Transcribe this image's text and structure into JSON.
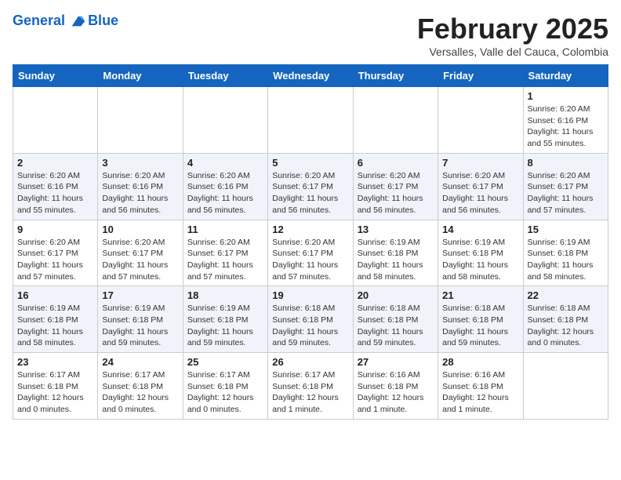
{
  "header": {
    "logo_line1": "General",
    "logo_line2": "Blue",
    "month": "February 2025",
    "location": "Versalles, Valle del Cauca, Colombia"
  },
  "days_of_week": [
    "Sunday",
    "Monday",
    "Tuesday",
    "Wednesday",
    "Thursday",
    "Friday",
    "Saturday"
  ],
  "weeks": [
    [
      {
        "day": "",
        "info": ""
      },
      {
        "day": "",
        "info": ""
      },
      {
        "day": "",
        "info": ""
      },
      {
        "day": "",
        "info": ""
      },
      {
        "day": "",
        "info": ""
      },
      {
        "day": "",
        "info": ""
      },
      {
        "day": "1",
        "info": "Sunrise: 6:20 AM\nSunset: 6:16 PM\nDaylight: 11 hours\nand 55 minutes."
      }
    ],
    [
      {
        "day": "2",
        "info": "Sunrise: 6:20 AM\nSunset: 6:16 PM\nDaylight: 11 hours\nand 55 minutes."
      },
      {
        "day": "3",
        "info": "Sunrise: 6:20 AM\nSunset: 6:16 PM\nDaylight: 11 hours\nand 56 minutes."
      },
      {
        "day": "4",
        "info": "Sunrise: 6:20 AM\nSunset: 6:16 PM\nDaylight: 11 hours\nand 56 minutes."
      },
      {
        "day": "5",
        "info": "Sunrise: 6:20 AM\nSunset: 6:17 PM\nDaylight: 11 hours\nand 56 minutes."
      },
      {
        "day": "6",
        "info": "Sunrise: 6:20 AM\nSunset: 6:17 PM\nDaylight: 11 hours\nand 56 minutes."
      },
      {
        "day": "7",
        "info": "Sunrise: 6:20 AM\nSunset: 6:17 PM\nDaylight: 11 hours\nand 56 minutes."
      },
      {
        "day": "8",
        "info": "Sunrise: 6:20 AM\nSunset: 6:17 PM\nDaylight: 11 hours\nand 57 minutes."
      }
    ],
    [
      {
        "day": "9",
        "info": "Sunrise: 6:20 AM\nSunset: 6:17 PM\nDaylight: 11 hours\nand 57 minutes."
      },
      {
        "day": "10",
        "info": "Sunrise: 6:20 AM\nSunset: 6:17 PM\nDaylight: 11 hours\nand 57 minutes."
      },
      {
        "day": "11",
        "info": "Sunrise: 6:20 AM\nSunset: 6:17 PM\nDaylight: 11 hours\nand 57 minutes."
      },
      {
        "day": "12",
        "info": "Sunrise: 6:20 AM\nSunset: 6:17 PM\nDaylight: 11 hours\nand 57 minutes."
      },
      {
        "day": "13",
        "info": "Sunrise: 6:19 AM\nSunset: 6:18 PM\nDaylight: 11 hours\nand 58 minutes."
      },
      {
        "day": "14",
        "info": "Sunrise: 6:19 AM\nSunset: 6:18 PM\nDaylight: 11 hours\nand 58 minutes."
      },
      {
        "day": "15",
        "info": "Sunrise: 6:19 AM\nSunset: 6:18 PM\nDaylight: 11 hours\nand 58 minutes."
      }
    ],
    [
      {
        "day": "16",
        "info": "Sunrise: 6:19 AM\nSunset: 6:18 PM\nDaylight: 11 hours\nand 58 minutes."
      },
      {
        "day": "17",
        "info": "Sunrise: 6:19 AM\nSunset: 6:18 PM\nDaylight: 11 hours\nand 59 minutes."
      },
      {
        "day": "18",
        "info": "Sunrise: 6:19 AM\nSunset: 6:18 PM\nDaylight: 11 hours\nand 59 minutes."
      },
      {
        "day": "19",
        "info": "Sunrise: 6:18 AM\nSunset: 6:18 PM\nDaylight: 11 hours\nand 59 minutes."
      },
      {
        "day": "20",
        "info": "Sunrise: 6:18 AM\nSunset: 6:18 PM\nDaylight: 11 hours\nand 59 minutes."
      },
      {
        "day": "21",
        "info": "Sunrise: 6:18 AM\nSunset: 6:18 PM\nDaylight: 11 hours\nand 59 minutes."
      },
      {
        "day": "22",
        "info": "Sunrise: 6:18 AM\nSunset: 6:18 PM\nDaylight: 12 hours\nand 0 minutes."
      }
    ],
    [
      {
        "day": "23",
        "info": "Sunrise: 6:17 AM\nSunset: 6:18 PM\nDaylight: 12 hours\nand 0 minutes."
      },
      {
        "day": "24",
        "info": "Sunrise: 6:17 AM\nSunset: 6:18 PM\nDaylight: 12 hours\nand 0 minutes."
      },
      {
        "day": "25",
        "info": "Sunrise: 6:17 AM\nSunset: 6:18 PM\nDaylight: 12 hours\nand 0 minutes."
      },
      {
        "day": "26",
        "info": "Sunrise: 6:17 AM\nSunset: 6:18 PM\nDaylight: 12 hours\nand 1 minute."
      },
      {
        "day": "27",
        "info": "Sunrise: 6:16 AM\nSunset: 6:18 PM\nDaylight: 12 hours\nand 1 minute."
      },
      {
        "day": "28",
        "info": "Sunrise: 6:16 AM\nSunset: 6:18 PM\nDaylight: 12 hours\nand 1 minute."
      },
      {
        "day": "",
        "info": ""
      }
    ]
  ]
}
